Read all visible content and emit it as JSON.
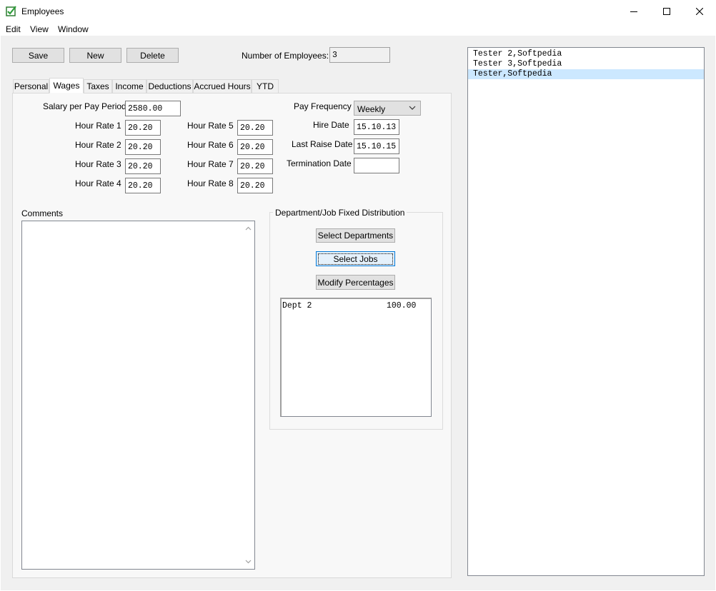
{
  "window": {
    "title": "Employees"
  },
  "menu": [
    "Edit",
    "View",
    "Window"
  ],
  "toolbar": {
    "save_label": "Save",
    "new_label": "New",
    "delete_label": "Delete",
    "employee_count_label": "Number of Employees:",
    "employee_count": "3"
  },
  "tabs": [
    "Personal",
    "Wages",
    "Taxes",
    "Income",
    "Deductions",
    "Accrued Hours",
    "YTD"
  ],
  "active_tab": "Wages",
  "wages": {
    "salary_label": "Salary per Pay Period",
    "salary_value": "2580.00",
    "hour_rates_left": [
      {
        "label": "Hour Rate 1",
        "value": "20.20"
      },
      {
        "label": "Hour Rate 2",
        "value": "20.20"
      },
      {
        "label": "Hour Rate 3",
        "value": "20.20"
      },
      {
        "label": "Hour Rate 4",
        "value": "20.20"
      }
    ],
    "hour_rates_right": [
      {
        "label": "Hour Rate 5",
        "value": "20.20"
      },
      {
        "label": "Hour Rate 6",
        "value": "20.20"
      },
      {
        "label": "Hour Rate 7",
        "value": "20.20"
      },
      {
        "label": "Hour Rate 8",
        "value": "20.20"
      }
    ],
    "pay_frequency_label": "Pay Frequency",
    "pay_frequency_value": "Weekly",
    "hire_date_label": "Hire Date",
    "hire_date_value": "15.10.13",
    "last_raise_label": "Last Raise Date",
    "last_raise_value": "15.10.15",
    "termination_label": "Termination Date",
    "termination_value": "",
    "comments_label": "Comments",
    "comments_value": ""
  },
  "distribution": {
    "group_title": "Department/Job Fixed Distribution",
    "select_departments_label": "Select Departments",
    "select_jobs_label": "Select Jobs",
    "modify_percentages_label": "Modify Percentages",
    "rows": [
      {
        "name": "Dept 2",
        "percent": "100.00"
      }
    ]
  },
  "employees": [
    {
      "name": "Tester 2,Softpedia",
      "selected": false
    },
    {
      "name": "Tester 3,Softpedia",
      "selected": false
    },
    {
      "name": "Tester,Softpedia",
      "selected": true
    }
  ],
  "colors": {
    "accent": "#0078d7",
    "selection": "#cce8ff",
    "window_bg": "#f0f0f0"
  }
}
